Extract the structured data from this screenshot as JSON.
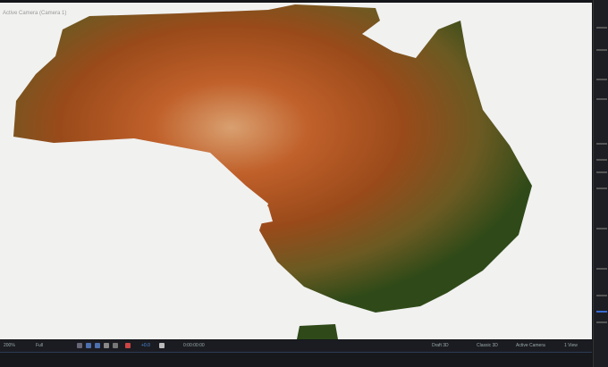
{
  "viewer": {
    "camera_label": "Active Camera (Camera 1)"
  },
  "toolbar": {
    "zoom": "200%",
    "resolution": "Full",
    "exposure": "+0.0",
    "timecode": "0:00:00:00",
    "draft": "Draft 3D",
    "renderer": "Classic 3D",
    "view": "Active Camera",
    "layout": "1 View"
  },
  "colors": {
    "land_red": "#b5521e",
    "land_green": "#3e5a1e",
    "background": "#f1f1f0",
    "accent": "#4c6fae"
  }
}
